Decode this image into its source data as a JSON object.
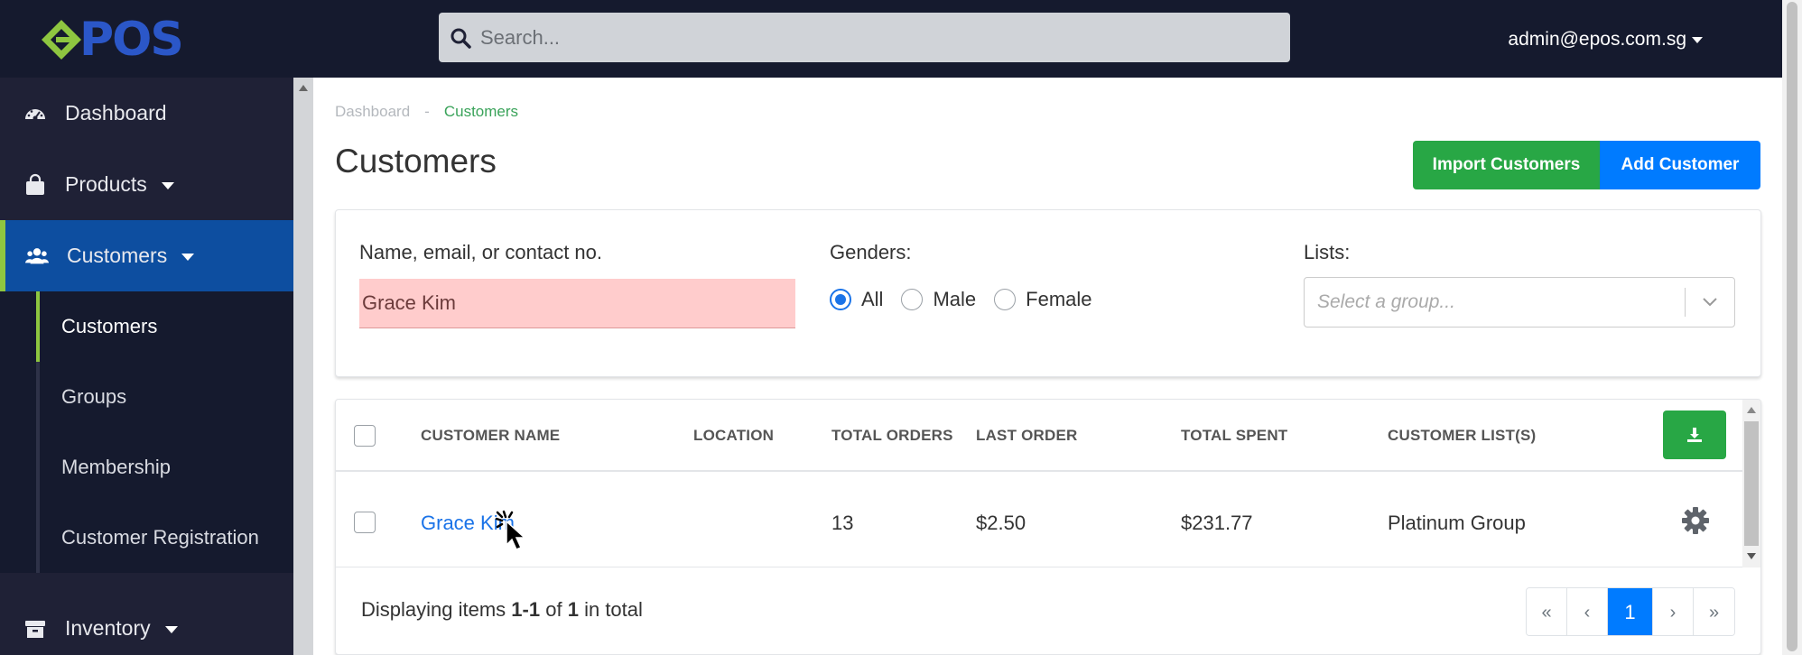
{
  "app": {
    "logo_text": "POS",
    "user_email": "admin@epos.com.sg"
  },
  "search": {
    "placeholder": "Search..."
  },
  "sidebar": {
    "items": [
      {
        "label": "Dashboard",
        "icon": "dashboard-icon"
      },
      {
        "label": "Products",
        "icon": "shopping-bag-icon",
        "has_caret": true
      },
      {
        "label": "Customers",
        "icon": "users-icon",
        "has_caret": true,
        "active": true
      },
      {
        "label": "Inventory",
        "icon": "archive-box-icon",
        "has_caret": true
      }
    ],
    "subitems": [
      {
        "label": "Customers",
        "active": true
      },
      {
        "label": "Groups"
      },
      {
        "label": "Membership"
      },
      {
        "label": "Customer Registration"
      }
    ]
  },
  "breadcrumb": {
    "home": "Dashboard",
    "sep": "-",
    "current": "Customers"
  },
  "page": {
    "title": "Customers",
    "import_label": "Import Customers",
    "add_label": "Add Customer"
  },
  "filters": {
    "name_label": "Name, email, or contact no.",
    "name_value": "Grace Kim",
    "genders_label": "Genders:",
    "gender_options": [
      "All",
      "Male",
      "Female"
    ],
    "gender_selected": "All",
    "lists_label": "Lists:",
    "lists_placeholder": "Select a group..."
  },
  "table": {
    "headers": [
      "CUSTOMER NAME",
      "LOCATION",
      "TOTAL ORDERS",
      "LAST ORDER",
      "TOTAL SPENT",
      "CUSTOMER LIST(S)"
    ],
    "rows": [
      {
        "name": "Grace Kim",
        "location": "",
        "total_orders": "13",
        "last_order": "$2.50",
        "total_spent": "$231.77",
        "lists": "Platinum Group"
      }
    ],
    "summary_prefix": "Displaying items",
    "summary_range": "1-1",
    "summary_of": "of",
    "summary_total": "1",
    "summary_suffix": "in total"
  },
  "pagination": {
    "first": "«",
    "prev": "‹",
    "current": "1",
    "next": "›",
    "last": "»"
  },
  "colors": {
    "topbar": "#151a2e",
    "sidebar": "#1f2136",
    "active_nav": "#0d4ea0",
    "accent_green": "#8ec640",
    "button_green": "#28a745",
    "button_blue": "#007bff",
    "link_blue": "#1a73e8",
    "invalid_input": "#ffcccc"
  }
}
